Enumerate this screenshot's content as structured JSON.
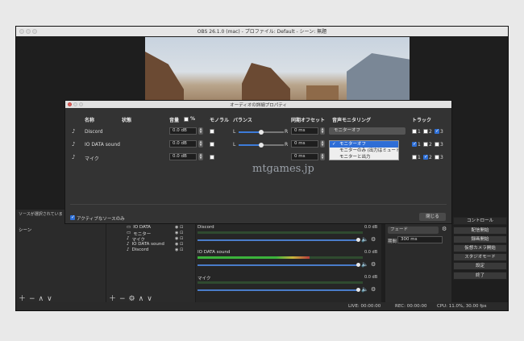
{
  "window": {
    "title": "OBS 26.1.0 (mac) - プロファイル: Default - シーン: 無題"
  },
  "scenes_dock": {
    "hint": "ソースが選択されていま",
    "header": "シーン",
    "item": "シーン"
  },
  "sources": {
    "items": [
      {
        "name": "IO DATA"
      },
      {
        "name": "モニター"
      },
      {
        "name": "マイク"
      },
      {
        "name": "IO DATA sound"
      },
      {
        "name": "Discord"
      }
    ]
  },
  "mixer": {
    "channels": [
      {
        "name": "Discord",
        "db": "0.0 dB",
        "level": 0.0
      },
      {
        "name": "IO DATA sound",
        "db": "0.0 dB",
        "level": 0.68
      },
      {
        "name": "マイク",
        "db": "0.0 dB",
        "level": 0.0
      }
    ]
  },
  "transitions": {
    "type": "フェード",
    "duration_label": "期間",
    "duration": "300 ms"
  },
  "controls": {
    "header": "コントロール",
    "buttons": [
      "配信開始",
      "録画開始",
      "仮想カメラ開始",
      "スタジオモード",
      "設定",
      "終了"
    ]
  },
  "status": {
    "live": "LIVE: 00:00:00",
    "rec": "REC: 00:00:00",
    "cpu": "CPU: 11.0%, 30.00 fps"
  },
  "dialog": {
    "title": "オーディオの詳細プロパティ",
    "headers": {
      "name": "名称",
      "state": "状態",
      "volume": "音量",
      "percent": "%",
      "mono": "モノラル",
      "balance": "バランス",
      "sync": "同期オフセット",
      "monitor": "音声モニタリング",
      "tracks": "トラック"
    },
    "balance_left": "L",
    "balance_right": "R",
    "rows": [
      {
        "name": "Discord",
        "state": "",
        "volume": "0.0 dB",
        "sync": "0 ms",
        "monitor": "モニターオフ",
        "tracks": [
          {
            "n": "1",
            "on": false
          },
          {
            "n": "2",
            "on": false
          },
          {
            "n": "3",
            "on": true
          }
        ]
      },
      {
        "name": "IO DATA sound",
        "state": "",
        "volume": "0.0 dB",
        "sync": "0 ms",
        "monitor": "モニターオフ",
        "tracks": [
          {
            "n": "1",
            "on": true
          },
          {
            "n": "2",
            "on": false
          },
          {
            "n": "3",
            "on": false
          }
        ]
      },
      {
        "name": "マイク",
        "state": "",
        "volume": "0.0 dB",
        "sync": "0 ms",
        "monitor": "モニターオフ",
        "tracks": [
          {
            "n": "1",
            "on": false
          },
          {
            "n": "2",
            "on": true
          },
          {
            "n": "3",
            "on": false
          }
        ]
      }
    ],
    "dropdown_options": [
      "モニターオフ",
      "モニターのみ (出力はミュート)",
      "モニターと出力"
    ],
    "active_only": "アクティブなソースのみ",
    "close": "閉じる"
  },
  "watermark": "mtgames.jp"
}
